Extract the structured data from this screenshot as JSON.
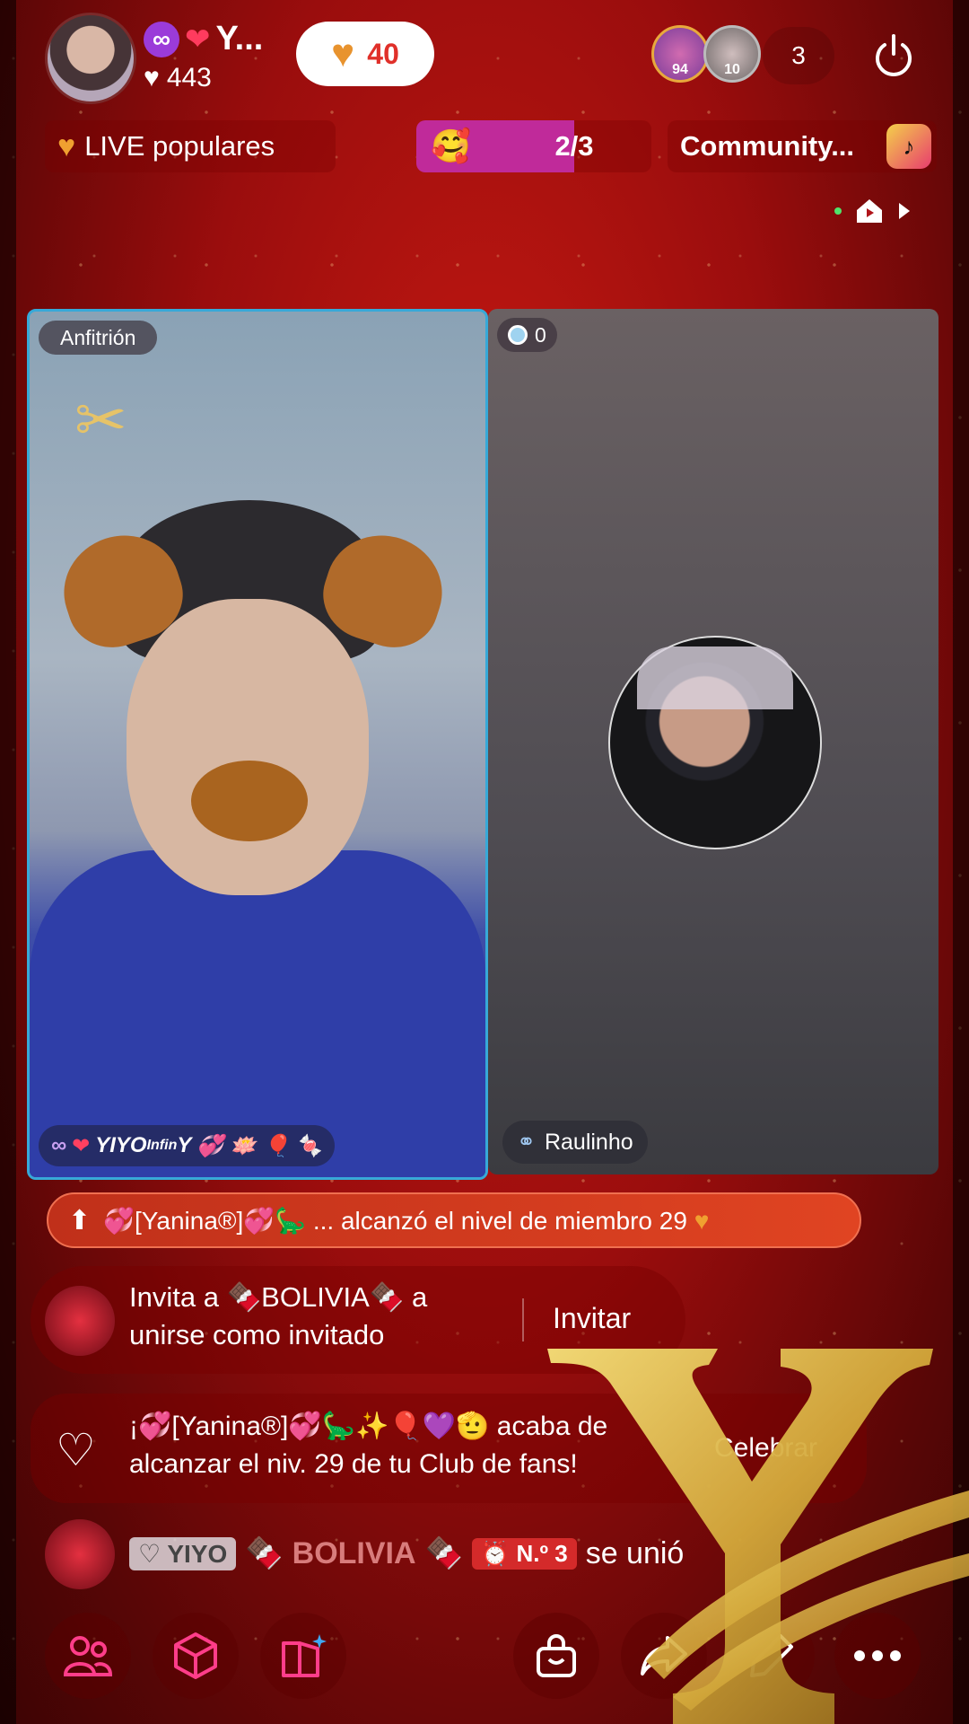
{
  "header": {
    "host_name": "Y...",
    "host_likes": "443",
    "like_pill_count": "40",
    "viewer_badges": [
      "94",
      "10"
    ],
    "viewer_count": "3"
  },
  "pills": {
    "live_populares": "LIVE populares",
    "progress_text": "2/3",
    "progress_fraction": 0.67,
    "community": "Community..."
  },
  "tiles": {
    "host_label": "Anfitrión",
    "host_tag": "YIYO",
    "host_tag_suffix": "Infin",
    "host_tag_tail": "Y",
    "guest_likes": "0",
    "guest_name": "Raulinho"
  },
  "chat": {
    "banner_prefix": "[Yanina®]",
    "banner_text": "... alcanzó el nivel de miembro 29",
    "invite_line1_a": "Invita a ",
    "invite_bolivia": "BOLIVIA",
    "invite_line1_b": " a",
    "invite_line2": "unirse como invitado",
    "invite_button": "Invitar",
    "fan_line1_a": "¡",
    "fan_name": "[Yanina®]",
    "fan_line1_b": " acaba de",
    "fan_line2": "alcanzar el niv. 29 de tu Club de fans!",
    "fan_button": "Celebrar",
    "join_tag": "YIYO",
    "join_name": "BOLIVIA",
    "join_rank": "N.º 3",
    "join_text": "se unió"
  },
  "colors": {
    "accent_pink": "#c02a9a",
    "banner_red": "#d63a20",
    "host_border": "#37a9d8"
  }
}
